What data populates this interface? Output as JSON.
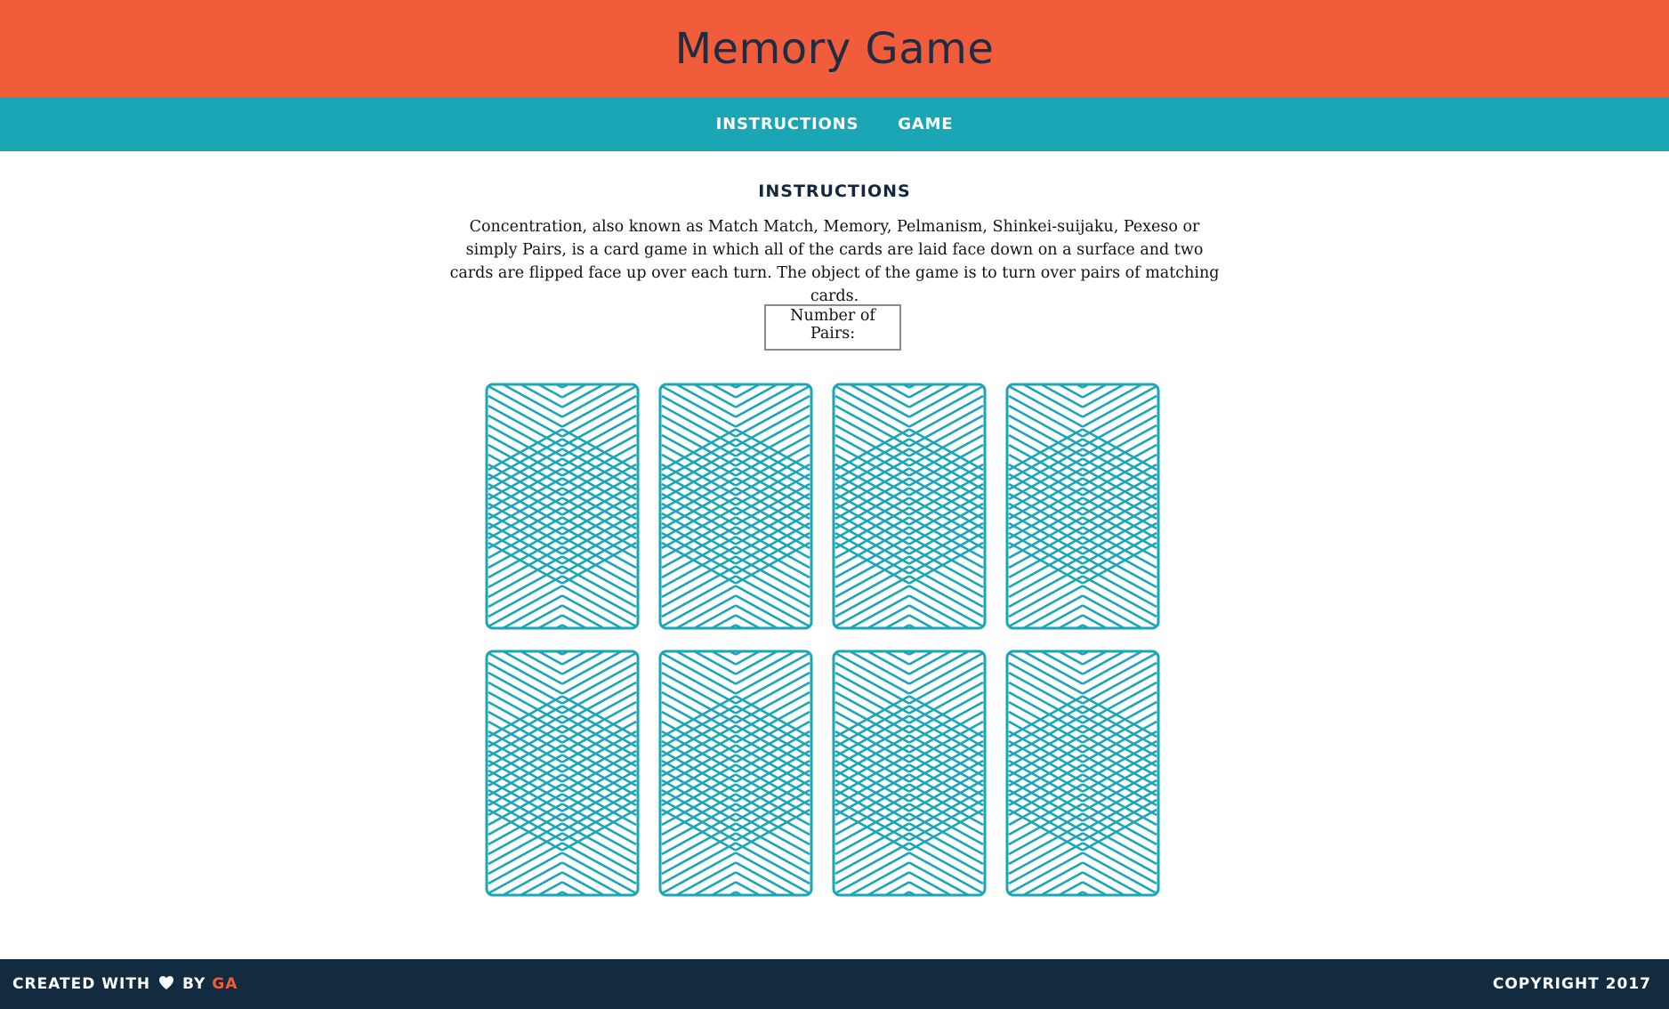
{
  "header": {
    "title": "Memory Game"
  },
  "nav": {
    "items": [
      {
        "label": "INSTRUCTIONS"
      },
      {
        "label": "GAME"
      }
    ]
  },
  "instructions": {
    "heading": "INSTRUCTIONS",
    "text": "Concentration, also known as Match Match, Memory, Pelmanism, Shinkei-suijaku, Pexeso or simply Pairs, is a card game in which all of the cards are laid face down on a surface and two cards are flipped face up over each turn. The object of the game is to turn over pairs of matching cards.",
    "pairs_label": "Number of Pairs:",
    "pairs_value": ""
  },
  "board": {
    "card_count": 8,
    "card_back_icon": "card-back-pattern",
    "card_color": "#1aa6b5"
  },
  "footer": {
    "left_prefix": "CREATED WITH",
    "heart_icon": "heart-icon",
    "by": "BY",
    "author": "GA",
    "copyright": "COPYRIGHT 2017"
  },
  "colors": {
    "header_bg": "#f15c3b",
    "nav_bg": "#1aa6b5",
    "footer_bg": "#122b3e",
    "title_text": "#1d2d44",
    "accent": "#f15c3b"
  }
}
